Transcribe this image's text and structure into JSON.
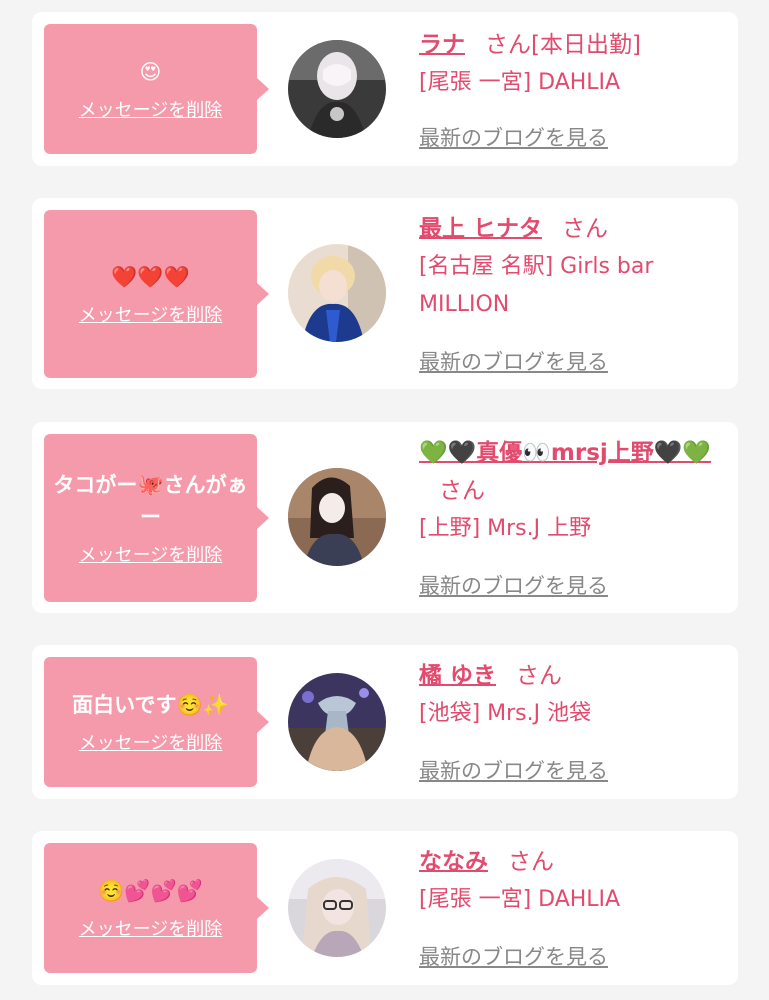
{
  "items": [
    {
      "message": "😍",
      "delete_label": "メッセージを削除",
      "name": "ラナ",
      "honorific": "さん",
      "status": "[本日出勤]",
      "shop": "[尾張 一宮] DAHLIA",
      "blog_label": "最新のブログを見る"
    },
    {
      "message": "❤️❤️❤️",
      "delete_label": "メッセージを削除",
      "name": "最上 ヒナタ",
      "honorific": "さん",
      "shop": "[名古屋 名駅] Girls bar MILLION",
      "blog_label": "最新のブログを見る"
    },
    {
      "message": "タコがー🐙さんがぁー",
      "delete_label": "メッセージを削除",
      "name": "💚🖤真優👀mrsj上野🖤💚",
      "honorific": "さん",
      "shop": "[上野] Mrs.J 上野",
      "blog_label": "最新のブログを見る"
    },
    {
      "message": "面白いです☺️✨",
      "delete_label": "メッセージを削除",
      "name": "橘 ゆき",
      "honorific": "さん",
      "shop": "[池袋] Mrs.J 池袋",
      "blog_label": "最新のブログを見る"
    },
    {
      "message": "☺️💕💕💕",
      "delete_label": "メッセージを削除",
      "name": "ななみ",
      "honorific": "さん",
      "shop": "[尾張 一宮] DAHLIA",
      "blog_label": "最新のブログを見る"
    }
  ],
  "colors": {
    "accent": "#e24a6e",
    "bubble": "#f59aab",
    "background": "#f4f4f4"
  }
}
